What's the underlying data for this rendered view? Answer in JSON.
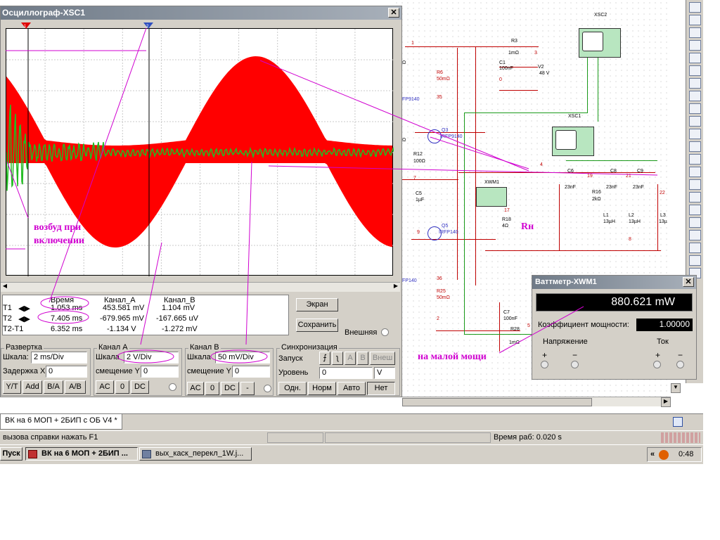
{
  "scope": {
    "title": "Осциллограф-XSC1",
    "table": {
      "headers": [
        "",
        "Время",
        "Канал_A",
        "Канал_B"
      ],
      "rows": [
        {
          "label": "T1",
          "time": "1.053 ms",
          "a": "453.581 mV",
          "b": "1.104 mV"
        },
        {
          "label": "T2",
          "time": "7.405 ms",
          "a": "-679.965 mV",
          "b": "-167.665 uV"
        },
        {
          "label": "T2-T1",
          "time": "6.352 ms",
          "a": "-1.134 V",
          "b": "-1.272 mV"
        }
      ]
    },
    "buttons": {
      "screen": "Экран",
      "save": "Сохранить",
      "external": "Внешняя"
    },
    "timebase": {
      "title": "Развертка",
      "scale_label": "Шкала:",
      "scale_value": "2 ms/Div",
      "delay_label": "Задержка X",
      "delay_value": "0",
      "modes": [
        "Y/T",
        "Add",
        "B/A",
        "A/B"
      ]
    },
    "channel_a": {
      "title": "Канал A",
      "scale_label": "Шкала",
      "scale_value": "2 V/Div",
      "offset_label": "смещение Y",
      "offset_value": "0",
      "coupling": [
        "AC",
        "0",
        "DC"
      ]
    },
    "channel_b": {
      "title": "Канал B",
      "scale_label": "Шкала",
      "scale_value": "50 mV/Div",
      "offset_label": "смещение Y",
      "offset_value": "0",
      "coupling": [
        "AC",
        "0",
        "DC",
        "-"
      ]
    },
    "trigger": {
      "title": "Синхронизация",
      "edge_label": "Запуск",
      "edge_buttons": [
        "A",
        "B",
        "Внеш"
      ],
      "level_label": "Уровень",
      "level_value": "0",
      "level_unit": "V",
      "modes": [
        "Одн.",
        "Норм",
        "Авто",
        "Нет"
      ]
    },
    "colors": {
      "channel_a": "#ff0000",
      "channel_b": "#22bb22",
      "cursor": "#000000"
    }
  },
  "wattmeter": {
    "title": "Ваттметр-XWM1",
    "reading": "880.621 mW",
    "pf_label": "Коэффициент мощности:",
    "pf_value": "1.00000",
    "voltage_label": "Напряжение",
    "current_label": "Ток"
  },
  "schematic": {
    "labels": {
      "r3": "R3",
      "r3v": "1mΩ",
      "c1": "C1",
      "c1v": "100nF",
      "v2": "V2",
      "v2v": "48 V",
      "xsc2": "XSC2",
      "xsc1": "XSC1",
      "r6": "R6",
      "r6v": "50mΩ",
      "q3": "Q3",
      "q3v": "IRFP9140",
      "fp9140": "FP9140",
      "r12": "R12",
      "r12v": "100Ω",
      "c5": "C5",
      "c5v": "1µF",
      "q5": "Q5",
      "q5v": "IRFP140",
      "fp140": "FP140",
      "r25": "R25",
      "r25v": "50mΩ",
      "xwm1": "XWM1",
      "r18": "R18",
      "r18v": "4Ω",
      "c6": "C6",
      "c6v": "23nF",
      "c8": "C8",
      "c8v": "23nF",
      "c9": "C9",
      "c9v": "23nF",
      "r16": "R16",
      "r16v": "2kΩ",
      "l1": "L1",
      "l1v": "13µH",
      "l2": "L2",
      "l2v": "13µH",
      "l3": "L3",
      "l3v": "13µ",
      "c7": "C7",
      "c7v": "100nF",
      "r28": "R28",
      "r28v": "1mΩ",
      "omega": "Ω"
    },
    "nodes": [
      "1",
      "3",
      "0",
      "35",
      "7",
      "9",
      "36",
      "2",
      "4",
      "19",
      "21",
      "22",
      "17",
      "8",
      "5"
    ]
  },
  "annotations": {
    "rn": "Rн",
    "excitation": "возбуд при\nвключении",
    "low_power": "на малой мощи"
  },
  "tab": {
    "label": "ВК на 6 МОП + 2БИП с ОБ V4 *"
  },
  "status": {
    "help": "вызова справки нажать F1",
    "runtime": "Время раб: 0.020 s"
  },
  "taskbar": {
    "start": "Пуск",
    "items": [
      "ВК на 6 МОП + 2БИП ...",
      "вых_каск_перекл_1W.j..."
    ],
    "clock": "0:48"
  }
}
